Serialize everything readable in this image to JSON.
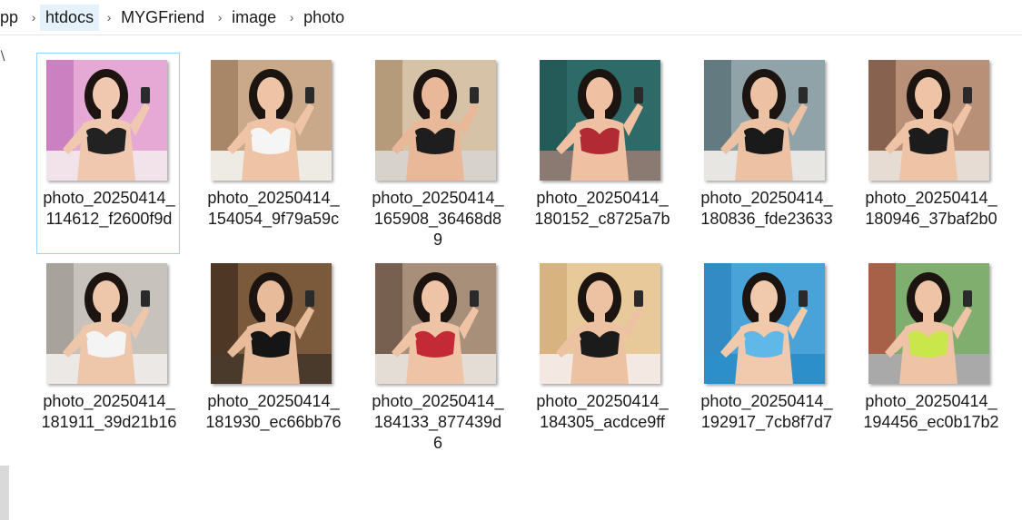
{
  "breadcrumb": [
    "pp",
    "htdocs",
    "MYGFriend",
    "image",
    "photo"
  ],
  "files": [
    {
      "name": "photo_20250414_114612_f2600f9d",
      "bg": "#e6a9d6",
      "accent": "#b55fb0",
      "top": "#222222",
      "skin": "#f0c8b0",
      "floor": "#f2e3ea"
    },
    {
      "name": "photo_20250414_154054_9f79a59c",
      "bg": "#c9a98a",
      "accent": "#8c6a4c",
      "top": "#f5f5f5",
      "skin": "#efc4a6",
      "floor": "#eeeae4"
    },
    {
      "name": "photo_20250414_165908_36468d89",
      "bg": "#d6c2a6",
      "accent": "#9c7c58",
      "top": "#1e1e1e",
      "skin": "#e8b898",
      "floor": "#d8d2cc"
    },
    {
      "name": "photo_20250414_180152_c8725a7b",
      "bg": "#2e6a68",
      "accent": "#1d4c4a",
      "top": "#b22a34",
      "skin": "#efc1a2",
      "floor": "#8a7a72"
    },
    {
      "name": "photo_20250414_180836_fde23633",
      "bg": "#8fa3a8",
      "accent": "#3f5a60",
      "top": "#1a1a1a",
      "skin": "#edc2a4",
      "floor": "#e8e6e2"
    },
    {
      "name": "photo_20250414_180946_37baf2b0",
      "bg": "#b89078",
      "accent": "#5e3e2e",
      "top": "#1c1c1c",
      "skin": "#efc3a6",
      "floor": "#e6dcd4"
    },
    {
      "name": "photo_20250414_181911_39d21b16",
      "bg": "#c8c2bc",
      "accent": "#8e8882",
      "top": "#f4f4f4",
      "skin": "#eec6aa",
      "floor": "#ebe8e6"
    },
    {
      "name": "photo_20250414_181930_ec66bb76",
      "bg": "#7a5a3a",
      "accent": "#2a1e14",
      "top": "#151515",
      "skin": "#e8bc9a",
      "floor": "#4a3a2c"
    },
    {
      "name": "photo_20250414_184133_877439d6",
      "bg": "#a88f7a",
      "accent": "#4e3a2c",
      "top": "#c42a36",
      "skin": "#efc4a6",
      "floor": "#e4ddd6"
    },
    {
      "name": "photo_20250414_184305_acdce9ff",
      "bg": "#e8c99a",
      "accent": "#c9a06a",
      "top": "#1b1b1b",
      "skin": "#edc2a2",
      "floor": "#f3e8e2"
    },
    {
      "name": "photo_20250414_192917_7cb8f7d7",
      "bg": "#4aa3d8",
      "accent": "#1f78b4",
      "top": "#5fb8e8",
      "skin": "#f1caae",
      "floor": "#2d8fc9"
    },
    {
      "name": "photo_20250414_194456_ec0b17b2",
      "bg": "#7fae6e",
      "accent": "#c8222a",
      "top": "#c9e64a",
      "skin": "#efc3a5",
      "floor": "#a9a9a9"
    }
  ]
}
